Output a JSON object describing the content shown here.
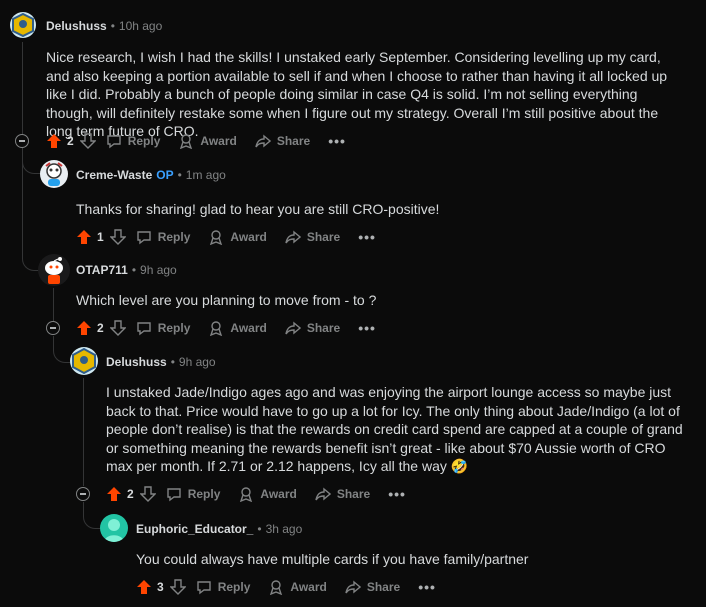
{
  "comments": [
    {
      "user": "Delushuss",
      "time": "10h ago",
      "text": "Nice research, I wish I had the skills! I unstaked early September. Considering levelling up my card, and also keeping a portion available to sell if and when I choose to rather than having it all locked up like I did. Probably a bunch of people doing similar in case Q4 is solid. I’m not selling everything though, will definitely restake some when I figure out my strategy. Overall I’m still positive about the long term future of CRO.",
      "votes": "2"
    },
    {
      "user": "Creme-Waste",
      "op_badge": "OP",
      "time": "1m ago",
      "text": "Thanks for sharing! glad to hear you are still CRO-positive!",
      "votes": "1"
    },
    {
      "user": "OTAP711",
      "time": "9h ago",
      "text": "Which level are you planning to move from - to ?",
      "votes": "2"
    },
    {
      "user": "Delushuss",
      "time": "9h ago",
      "text": "I unstaked Jade/Indigo ages ago and was enjoying the airport lounge access so maybe just back to that. Price would have to go up a lot for Icy. The only thing about Jade/Indigo (a lot of people don’t realise) is that the rewards on credit card spend are capped at a couple of grand or something meaning the rewards benefit isn’t great - like about $70 Aussie worth of CRO max per month. If 2.71 or 2.12 happens, Icy all the way 🤣",
      "votes": "2"
    },
    {
      "user": "Euphoric_Educator_",
      "time": "3h ago",
      "text": "You could always have multiple cards if you have family/partner",
      "votes": "3"
    }
  ],
  "labels": {
    "dot": "•",
    "reply": "Reply",
    "award": "Award",
    "share": "Share",
    "more": "•••"
  },
  "colors": {
    "background": "#0b0b0b",
    "upvote": "#ff4500",
    "muted": "#818384",
    "op": "#3aa0ff"
  },
  "icons": [
    "upvote-icon",
    "downvote-icon",
    "reply-icon",
    "award-icon",
    "share-icon",
    "more-icon",
    "collapse-icon"
  ]
}
